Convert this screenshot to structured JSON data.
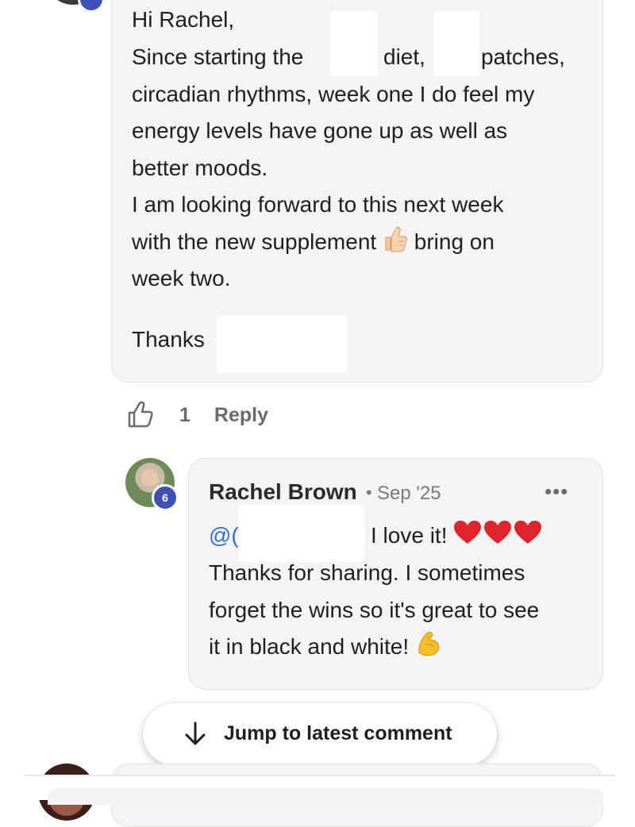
{
  "comment1": {
    "greeting": "Hi Rachel,",
    "line2_part1": "Since starting the",
    "line2_part2": "diet,",
    "line2_part3": "patches,",
    "line3": "circadian rhythms, week one I do feel my",
    "line4": "energy levels have gone up as well as",
    "line5": "better moods.",
    "line6": "I am looking forward to this next week",
    "line7_part1": "with the new supplement",
    "line7_emoji": "thumbs-up-emoji",
    "line7_part2": "bring on",
    "line8": "week two.",
    "closing": "Thanks",
    "like_count": "1",
    "reply_label": "Reply",
    "like_icon": "thumbs-up-outline-icon"
  },
  "reply": {
    "author": "Rachel Brown",
    "separator": "•",
    "date": "Sep '25",
    "badge_level": "6",
    "more_label": "•••",
    "mention": "@(",
    "line1_text": "I love it!",
    "line1_emoji": "red-heart-emoji x3",
    "line2": "Thanks for sharing. I sometimes",
    "line3": "forget the wins so it's great to see",
    "line4": "it in black and white!",
    "line4_emoji": "flexed-biceps-emoji"
  },
  "jump_button": {
    "label": "Jump to latest comment",
    "icon": "arrow-down-icon"
  },
  "colors": {
    "bubble_bg": "#f5f4f3",
    "mention": "#2f6fd6",
    "badge": "#3f51b5",
    "muted_text": "#6b6b6b",
    "heart": "#e0242b"
  }
}
